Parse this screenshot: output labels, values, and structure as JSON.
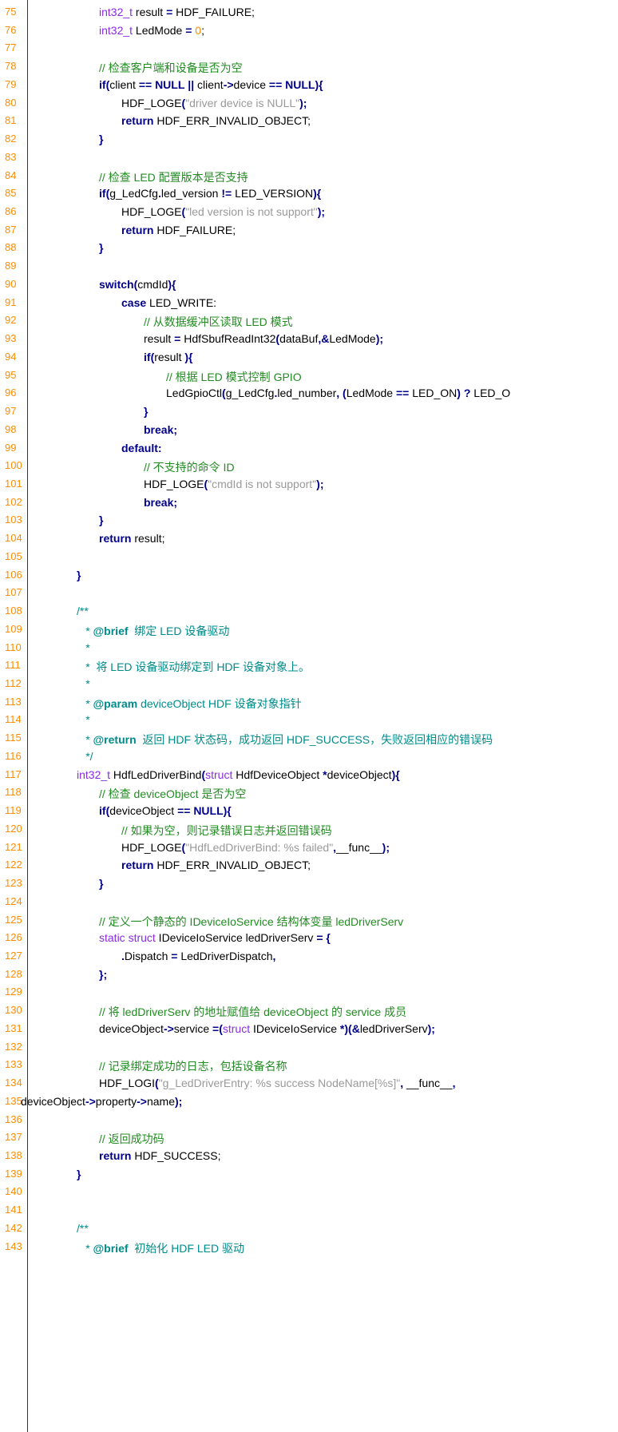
{
  "colors": {
    "line_number": "#ff8c00",
    "type": "#8a2be2",
    "keyword": "#00008b",
    "number": "#ff8c00",
    "string": "#999999",
    "comment": "#228b22",
    "doc_comment": "#008b8b"
  },
  "lines": [
    {
      "n": "75",
      "indent": 4,
      "tokens": [
        [
          "t",
          "int32_t"
        ],
        [
          "p",
          " result "
        ],
        [
          "o",
          "="
        ],
        [
          "p",
          " HDF_FAILURE;"
        ]
      ]
    },
    {
      "n": "76",
      "indent": 4,
      "tokens": [
        [
          "t",
          "int32_t"
        ],
        [
          "p",
          " LedMode "
        ],
        [
          "o",
          "="
        ],
        [
          "p",
          " "
        ],
        [
          "num",
          "0"
        ],
        [
          "p",
          ";"
        ]
      ]
    },
    {
      "n": "77",
      "indent": 0,
      "tokens": []
    },
    {
      "n": "78",
      "indent": 4,
      "tokens": [
        [
          "c",
          "// 检查客户端和设备是否为空"
        ]
      ]
    },
    {
      "n": "79",
      "indent": 4,
      "tokens": [
        [
          "k",
          "if"
        ],
        [
          "o",
          "("
        ],
        [
          "p",
          "client "
        ],
        [
          "o",
          "=="
        ],
        [
          "p",
          " "
        ],
        [
          "k",
          "NULL"
        ],
        [
          "p",
          " "
        ],
        [
          "o",
          "||"
        ],
        [
          "p",
          " client"
        ],
        [
          "o",
          "->"
        ],
        [
          "p",
          "device "
        ],
        [
          "o",
          "=="
        ],
        [
          "p",
          " "
        ],
        [
          "k",
          "NULL"
        ],
        [
          "o",
          "){"
        ]
      ]
    },
    {
      "n": "80",
      "indent": 5,
      "tokens": [
        [
          "p",
          "HDF_LOGE"
        ],
        [
          "o",
          "("
        ],
        [
          "s",
          "\"driver device is NULL\""
        ],
        [
          "o",
          ");"
        ]
      ]
    },
    {
      "n": "81",
      "indent": 5,
      "tokens": [
        [
          "k",
          "return"
        ],
        [
          "p",
          " HDF_ERR_INVALID_OBJECT;"
        ]
      ]
    },
    {
      "n": "82",
      "indent": 4,
      "tokens": [
        [
          "o",
          "}"
        ]
      ]
    },
    {
      "n": "83",
      "indent": 0,
      "tokens": []
    },
    {
      "n": "84",
      "indent": 4,
      "tokens": [
        [
          "c",
          "// 检查 LED 配置版本是否支持"
        ]
      ]
    },
    {
      "n": "85",
      "indent": 4,
      "tokens": [
        [
          "k",
          "if"
        ],
        [
          "o",
          "("
        ],
        [
          "p",
          "g_LedCfg"
        ],
        [
          "o",
          "."
        ],
        [
          "p",
          "led_version "
        ],
        [
          "o",
          "!="
        ],
        [
          "p",
          " LED_VERSION"
        ],
        [
          "o",
          "){"
        ]
      ]
    },
    {
      "n": "86",
      "indent": 5,
      "tokens": [
        [
          "p",
          "HDF_LOGE"
        ],
        [
          "o",
          "("
        ],
        [
          "s",
          "\"led version is not support\""
        ],
        [
          "o",
          ");"
        ]
      ]
    },
    {
      "n": "87",
      "indent": 5,
      "tokens": [
        [
          "k",
          "return"
        ],
        [
          "p",
          " HDF_FAILURE;"
        ]
      ]
    },
    {
      "n": "88",
      "indent": 4,
      "tokens": [
        [
          "o",
          "}"
        ]
      ]
    },
    {
      "n": "89",
      "indent": 0,
      "tokens": []
    },
    {
      "n": "90",
      "indent": 4,
      "tokens": [
        [
          "k",
          "switch"
        ],
        [
          "o",
          "("
        ],
        [
          "p",
          "cmdId"
        ],
        [
          "o",
          "){"
        ]
      ]
    },
    {
      "n": "91",
      "indent": 5,
      "tokens": [
        [
          "k",
          "case"
        ],
        [
          "p",
          " LED_WRITE:"
        ]
      ]
    },
    {
      "n": "92",
      "indent": 6,
      "tokens": [
        [
          "c",
          "// 从数据缓冲区读取 LED 模式"
        ]
      ]
    },
    {
      "n": "93",
      "indent": 6,
      "tokens": [
        [
          "p",
          "result "
        ],
        [
          "o",
          "="
        ],
        [
          "p",
          " HdfSbufReadInt32"
        ],
        [
          "o",
          "("
        ],
        [
          "p",
          "dataBuf"
        ],
        [
          "o",
          ",&"
        ],
        [
          "p",
          "LedMode"
        ],
        [
          "o",
          ");"
        ]
      ]
    },
    {
      "n": "94",
      "indent": 6,
      "tokens": [
        [
          "k",
          "if"
        ],
        [
          "o",
          "("
        ],
        [
          "p",
          "result "
        ],
        [
          "o",
          "){"
        ]
      ]
    },
    {
      "n": "95",
      "indent": 7,
      "tokens": [
        [
          "c",
          "// 根据 LED 模式控制 GPIO"
        ]
      ]
    },
    {
      "n": "96",
      "indent": 7,
      "tokens": [
        [
          "p",
          "LedGpioCtl"
        ],
        [
          "o",
          "("
        ],
        [
          "p",
          "g_LedCfg"
        ],
        [
          "o",
          "."
        ],
        [
          "p",
          "led_number"
        ],
        [
          "o",
          ", ("
        ],
        [
          "p",
          "LedMode "
        ],
        [
          "o",
          "=="
        ],
        [
          "p",
          " LED_ON"
        ],
        [
          "o",
          ") ?"
        ],
        [
          "p",
          " LED_O"
        ]
      ]
    },
    {
      "n": "97",
      "indent": 6,
      "tokens": [
        [
          "o",
          "}"
        ]
      ]
    },
    {
      "n": "98",
      "indent": 6,
      "tokens": [
        [
          "k",
          "break"
        ],
        [
          "o",
          ";"
        ]
      ]
    },
    {
      "n": "99",
      "indent": 5,
      "tokens": [
        [
          "k",
          "default:"
        ]
      ]
    },
    {
      "n": "100",
      "indent": 6,
      "tokens": [
        [
          "c",
          "// 不支持的命令 ID"
        ]
      ]
    },
    {
      "n": "101",
      "indent": 6,
      "tokens": [
        [
          "p",
          "HDF_LOGE"
        ],
        [
          "o",
          "("
        ],
        [
          "s",
          "\"cmdId is not support\""
        ],
        [
          "o",
          ");"
        ]
      ]
    },
    {
      "n": "102",
      "indent": 6,
      "tokens": [
        [
          "k",
          "break"
        ],
        [
          "o",
          ";"
        ]
      ]
    },
    {
      "n": "103",
      "indent": 4,
      "tokens": [
        [
          "o",
          "}"
        ]
      ]
    },
    {
      "n": "104",
      "indent": 4,
      "tokens": [
        [
          "k",
          "return"
        ],
        [
          "p",
          " result;"
        ]
      ]
    },
    {
      "n": "105",
      "indent": 0,
      "tokens": []
    },
    {
      "n": "106",
      "indent": 3,
      "tokens": [
        [
          "o",
          "}"
        ]
      ]
    },
    {
      "n": "107",
      "indent": 0,
      "tokens": []
    },
    {
      "n": "108",
      "indent": 3,
      "tokens": [
        [
          "d",
          "/**"
        ]
      ]
    },
    {
      "n": "109",
      "indent": 3.4,
      "tokens": [
        [
          "d",
          "* "
        ],
        [
          "tag",
          "@brief"
        ],
        [
          "d",
          "  绑定 LED 设备驱动"
        ]
      ]
    },
    {
      "n": "110",
      "indent": 3.4,
      "tokens": [
        [
          "d",
          "*"
        ]
      ]
    },
    {
      "n": "111",
      "indent": 3.4,
      "tokens": [
        [
          "d",
          "*  将 LED 设备驱动绑定到 HDF 设备对象上。"
        ]
      ]
    },
    {
      "n": "112",
      "indent": 3.4,
      "tokens": [
        [
          "d",
          "*"
        ]
      ]
    },
    {
      "n": "113",
      "indent": 3.4,
      "tokens": [
        [
          "d",
          "* "
        ],
        [
          "tag",
          "@param"
        ],
        [
          "d",
          " deviceObject HDF 设备对象指针"
        ]
      ]
    },
    {
      "n": "114",
      "indent": 3.4,
      "tokens": [
        [
          "d",
          "*"
        ]
      ]
    },
    {
      "n": "115",
      "indent": 3.4,
      "tokens": [
        [
          "d",
          "* "
        ],
        [
          "tag",
          "@return"
        ],
        [
          "d",
          "  返回 HDF 状态码，成功返回 HDF_SUCCESS，失败返回相应的错误码"
        ]
      ]
    },
    {
      "n": "116",
      "indent": 3.4,
      "tokens": [
        [
          "d",
          "*/"
        ]
      ]
    },
    {
      "n": "117",
      "indent": 3,
      "tokens": [
        [
          "t",
          "int32_t"
        ],
        [
          "p",
          " HdfLedDriverBind"
        ],
        [
          "o",
          "("
        ],
        [
          "t",
          "struct"
        ],
        [
          "p",
          " HdfDeviceObject "
        ],
        [
          "o",
          "*"
        ],
        [
          "p",
          "deviceObject"
        ],
        [
          "o",
          "){"
        ]
      ]
    },
    {
      "n": "118",
      "indent": 4,
      "tokens": [
        [
          "c",
          "// 检查 deviceObject 是否为空"
        ]
      ]
    },
    {
      "n": "119",
      "indent": 4,
      "tokens": [
        [
          "k",
          "if"
        ],
        [
          "o",
          "("
        ],
        [
          "p",
          "deviceObject "
        ],
        [
          "o",
          "=="
        ],
        [
          "p",
          " "
        ],
        [
          "k",
          "NULL"
        ],
        [
          "o",
          "){"
        ]
      ]
    },
    {
      "n": "120",
      "indent": 5,
      "tokens": [
        [
          "c",
          "// 如果为空，则记录错误日志并返回错误码"
        ]
      ]
    },
    {
      "n": "121",
      "indent": 5,
      "tokens": [
        [
          "p",
          "HDF_LOGE"
        ],
        [
          "o",
          "("
        ],
        [
          "s",
          "\"HdfLedDriverBind: %s failed\""
        ],
        [
          "o",
          ","
        ],
        [
          "p",
          "__func__"
        ],
        [
          "o",
          ");"
        ]
      ]
    },
    {
      "n": "122",
      "indent": 5,
      "tokens": [
        [
          "k",
          "return"
        ],
        [
          "p",
          " HDF_ERR_INVALID_OBJECT;"
        ]
      ]
    },
    {
      "n": "123",
      "indent": 4,
      "tokens": [
        [
          "o",
          "}"
        ]
      ]
    },
    {
      "n": "124",
      "indent": 0,
      "tokens": []
    },
    {
      "n": "125",
      "indent": 4,
      "tokens": [
        [
          "c",
          "// 定义一个静态的 IDeviceIoService 结构体变量 ledDriverServ"
        ]
      ]
    },
    {
      "n": "126",
      "indent": 4,
      "tokens": [
        [
          "t",
          "static struct"
        ],
        [
          "p",
          " IDeviceIoService ledDriverServ "
        ],
        [
          "o",
          "="
        ],
        [
          "p",
          " "
        ],
        [
          "o",
          "{"
        ]
      ]
    },
    {
      "n": "127",
      "indent": 5,
      "tokens": [
        [
          "o",
          "."
        ],
        [
          "p",
          "Dispatch "
        ],
        [
          "o",
          "="
        ],
        [
          "p",
          " LedDriverDispatch"
        ],
        [
          "o",
          ","
        ]
      ]
    },
    {
      "n": "128",
      "indent": 4,
      "tokens": [
        [
          "o",
          "};"
        ]
      ]
    },
    {
      "n": "129",
      "indent": 0,
      "tokens": []
    },
    {
      "n": "130",
      "indent": 4,
      "tokens": [
        [
          "c",
          "// 将 ledDriverServ 的地址赋值给 deviceObject 的 service 成员"
        ]
      ]
    },
    {
      "n": "131",
      "indent": 4,
      "tokens": [
        [
          "p",
          "deviceObject"
        ],
        [
          "o",
          "->"
        ],
        [
          "p",
          "service "
        ],
        [
          "o",
          "=("
        ],
        [
          "t",
          "struct"
        ],
        [
          "p",
          " IDeviceIoService "
        ],
        [
          "o",
          "*)(&"
        ],
        [
          "p",
          "ledDriverServ"
        ],
        [
          "o",
          ");"
        ]
      ]
    },
    {
      "n": "132",
      "indent": 0,
      "tokens": []
    },
    {
      "n": "133",
      "indent": 4,
      "tokens": [
        [
          "c",
          "// 记录绑定成功的日志，包括设备名称"
        ]
      ]
    },
    {
      "n": "134",
      "indent": 4,
      "tokens": [
        [
          "p",
          "HDF_LOGI"
        ],
        [
          "o",
          "("
        ],
        [
          "s",
          "\"g_LedDriverEntry: %s success NodeName[%s]\""
        ],
        [
          "o",
          ","
        ],
        [
          "p",
          " __func__"
        ],
        [
          "o",
          ","
        ]
      ]
    },
    {
      "n": "135",
      "indent": 0.5,
      "tokens": [
        [
          "p",
          "deviceObject"
        ],
        [
          "o",
          "->"
        ],
        [
          "p",
          "property"
        ],
        [
          "o",
          "->"
        ],
        [
          "p",
          "name"
        ],
        [
          "o",
          ");"
        ]
      ]
    },
    {
      "n": "136",
      "indent": 0,
      "tokens": []
    },
    {
      "n": "137",
      "indent": 4,
      "tokens": [
        [
          "c",
          "// 返回成功码"
        ]
      ]
    },
    {
      "n": "138",
      "indent": 4,
      "tokens": [
        [
          "k",
          "return"
        ],
        [
          "p",
          " HDF_SUCCESS;"
        ]
      ]
    },
    {
      "n": "139",
      "indent": 3,
      "tokens": [
        [
          "o",
          "}"
        ]
      ]
    },
    {
      "n": "140",
      "indent": 0,
      "tokens": []
    },
    {
      "n": "141",
      "indent": 0,
      "tokens": []
    },
    {
      "n": "142",
      "indent": 3,
      "tokens": [
        [
          "d",
          "/**"
        ]
      ]
    },
    {
      "n": "143",
      "indent": 3.4,
      "tokens": [
        [
          "d",
          "* "
        ],
        [
          "tag",
          "@brief"
        ],
        [
          "d",
          "  初始化 HDF LED 驱动"
        ]
      ]
    }
  ]
}
